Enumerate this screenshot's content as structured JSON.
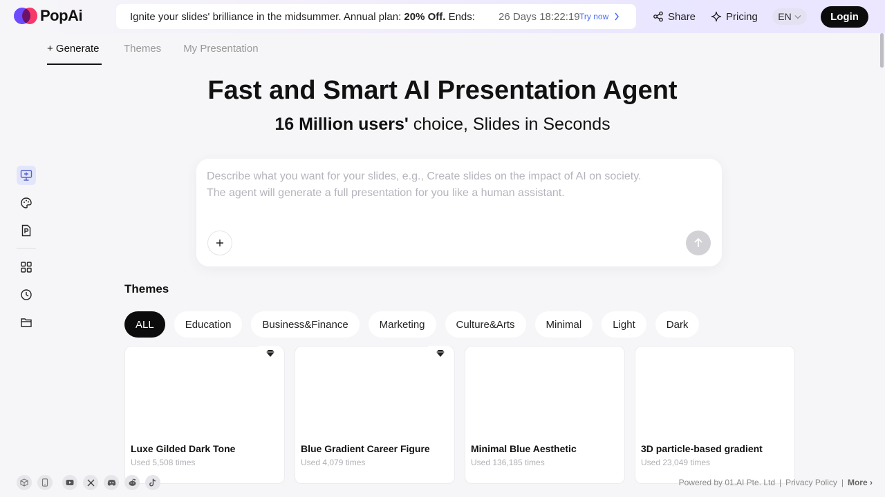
{
  "brand": {
    "name": "PopAi",
    "colors": {
      "accent": "#6c4bff",
      "secondary": "#ff3b6b",
      "dark": "#0c0c0c",
      "link": "#4a6cf7"
    }
  },
  "promo": {
    "text_before": "Ignite your slides' brilliance in the midsummer. Annual plan: ",
    "highlight": "20% Off.",
    "text_after": " Ends:",
    "countdown": "26 Days 18:22:19",
    "cta": "Try now"
  },
  "header": {
    "share_label": "Share",
    "pricing_label": "Pricing",
    "language": "EN",
    "login_label": "Login"
  },
  "tabs": [
    {
      "label": "+ Generate",
      "active": true
    },
    {
      "label": "Themes",
      "active": false
    },
    {
      "label": "My Presentation",
      "active": false
    }
  ],
  "sidebar": {
    "items": [
      {
        "icon": "presentation-icon",
        "active": true
      },
      {
        "icon": "palette-icon",
        "active": false
      },
      {
        "icon": "ppt-file-icon",
        "active": false
      },
      {
        "icon": "grid-icon",
        "active": false
      },
      {
        "icon": "history-clock-icon",
        "active": false
      },
      {
        "icon": "folder-icon",
        "active": false
      }
    ]
  },
  "hero": {
    "title": "Fast and Smart AI Presentation Agent",
    "subtitle_bold": "16 Million users'",
    "subtitle_rest": " choice, Slides in Seconds"
  },
  "prompt": {
    "placeholder_line1": "Describe what you want for your slides, e.g., Create slides on the impact of AI on society.",
    "placeholder_line2": "The agent will generate a full presentation for you like a human assistant."
  },
  "themes": {
    "heading": "Themes",
    "filters": [
      "ALL",
      "Education",
      "Business&Finance",
      "Marketing",
      "Culture&Arts",
      "Minimal",
      "Light",
      "Dark"
    ],
    "active_filter": "ALL",
    "cards": [
      {
        "title": "Luxe Gilded Dark Tone",
        "usage": "Used 5,508 times",
        "premium": true
      },
      {
        "title": "Blue Gradient Career Figure",
        "usage": "Used 4,079 times",
        "premium": true
      },
      {
        "title": "Minimal Blue Aesthetic",
        "usage": "Used 136,185 times",
        "premium": false
      },
      {
        "title": "3D particle-based gradient",
        "usage": "Used 23,049 times",
        "premium": false
      }
    ]
  },
  "footer": {
    "social_icons": [
      "cube-icon",
      "phone-icon",
      "youtube-icon",
      "x-icon",
      "discord-icon",
      "reddit-icon",
      "tiktok-icon"
    ],
    "powered_by": "Powered by 01.AI Pte. Ltd",
    "privacy": "Privacy Policy",
    "more": "More"
  }
}
